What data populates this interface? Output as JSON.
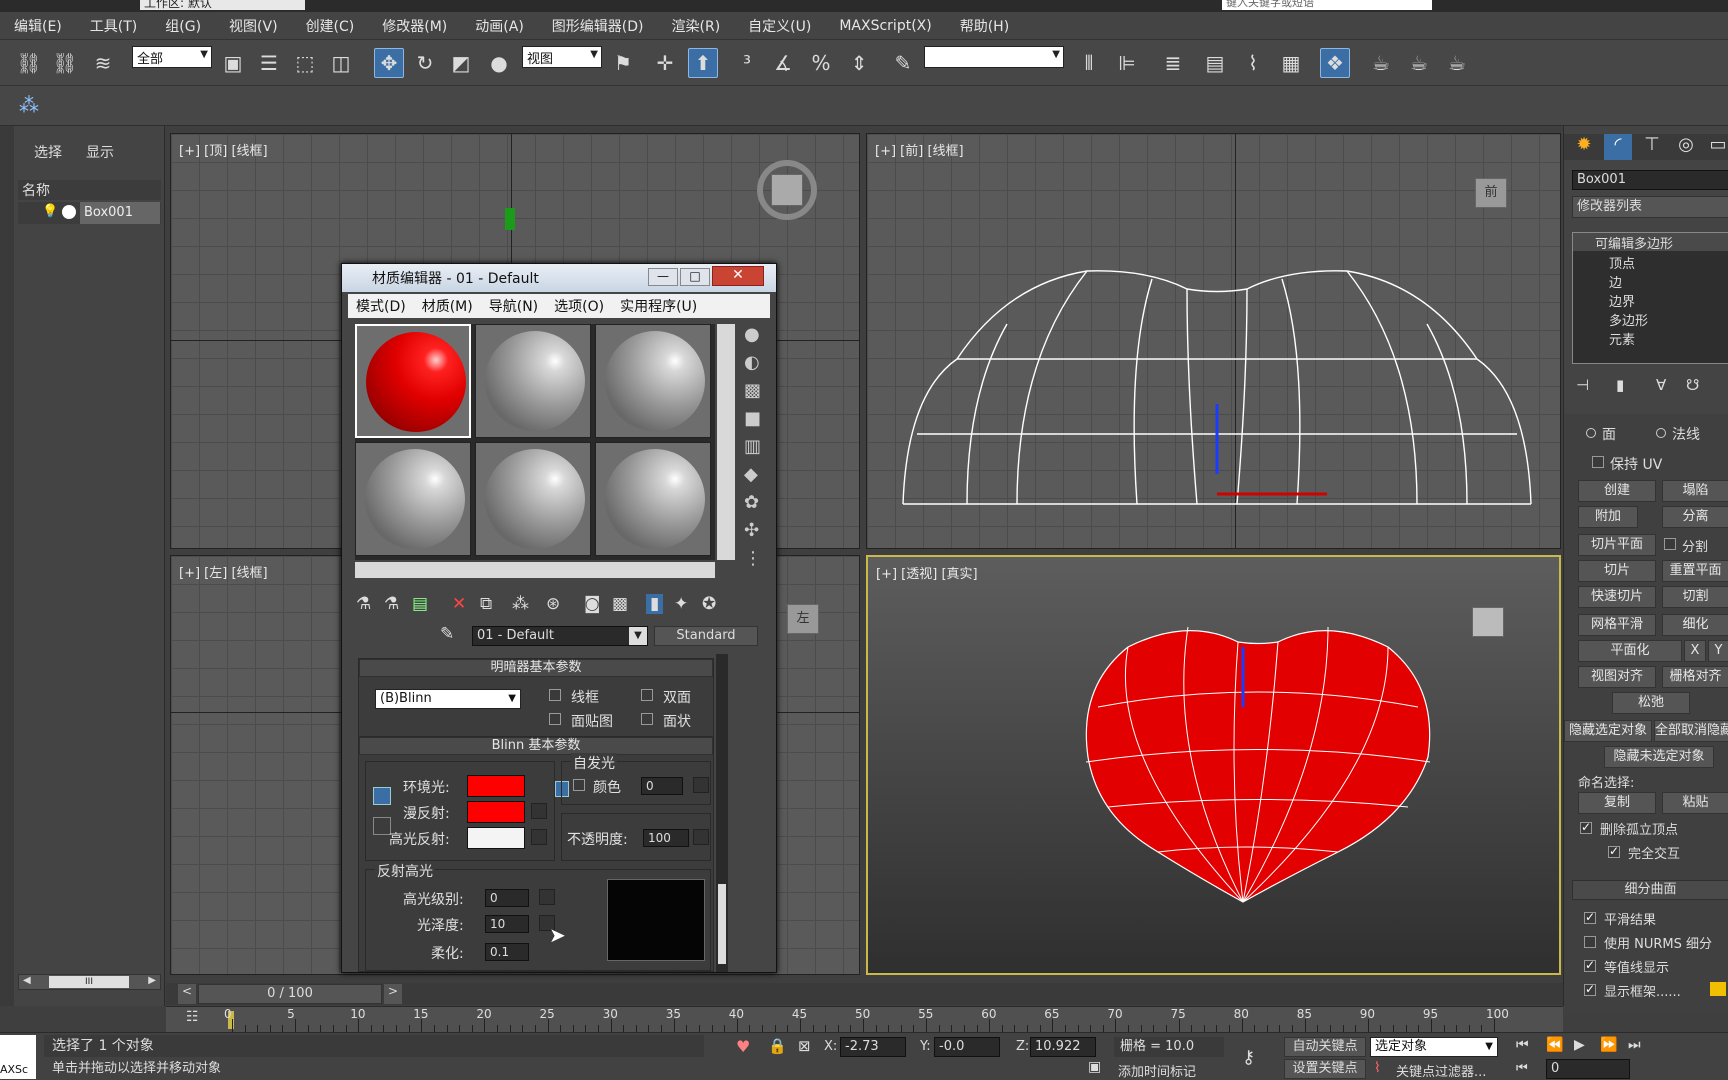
{
  "title": {
    "workspace_label": "工作区: 默认",
    "search_placeholder": "键入关键字或短语"
  },
  "menu": [
    "编辑(E)",
    "工具(T)",
    "组(G)",
    "视图(V)",
    "创建(C)",
    "修改器(M)",
    "动画(A)",
    "图形编辑器(D)",
    "渲染(R)",
    "自定义(U)",
    "MAXScript(X)",
    "帮助(H)"
  ],
  "toolbar": {
    "selection_filter": "全部",
    "ref_coord": "视图"
  },
  "explorer": {
    "tabs": [
      "选择",
      "显示"
    ],
    "column": "名称",
    "object": "Box001",
    "scroll_value": "III"
  },
  "viewports": {
    "top": "[+] [顶] [线框]",
    "front": "[+] [前] [线框]",
    "left": "[+] [左] [线框]",
    "persp": "[+] [透视] [真实]",
    "front_cube": "前",
    "left_cube": "左"
  },
  "mated": {
    "title": "材质编辑器 - 01 - Default",
    "menu": [
      "模式(D)",
      "材质(M)",
      "导航(N)",
      "选项(O)",
      "实用程序(U)"
    ],
    "material_name": "01 - Default",
    "material_type": "Standard",
    "shader_rollout": "明暗器基本参数",
    "shader": "(B)Blinn",
    "opt_wire": "线框",
    "opt_2side": "双面",
    "opt_facemap": "面贴图",
    "opt_faceted": "面状",
    "blinn_rollout": "Blinn 基本参数",
    "self_illum": "自发光",
    "color_label": "颜色",
    "self_illum_value": "0",
    "ambient": "环境光:",
    "diffuse": "漫反射:",
    "specular": "高光反射:",
    "opacity_label": "不透明度:",
    "opacity_value": "100",
    "spec_group": "反射高光",
    "spec_level_label": "高光级别:",
    "spec_level": "0",
    "gloss_label": "光泽度:",
    "gloss": "10",
    "soften_label": "柔化:",
    "soften": "0.1",
    "colors": {
      "ambient": "#ff0000",
      "diffuse": "#ff0000",
      "specular": "#f4f4f4"
    }
  },
  "cmd": {
    "object_name": "Box001",
    "modifier_list": "修改器列表",
    "stack": [
      "可编辑多边形",
      "顶点",
      "边",
      "边界",
      "多边形",
      "元素"
    ],
    "radio_face": "面",
    "radio_normal": "法线",
    "keep_uv": "保持 UV",
    "btn_create": "创建",
    "btn_collapse": "塌陷",
    "btn_attach": "附加",
    "btn_detach": "分离",
    "btn_slice_plane": "切片平面",
    "chk_split": "分割",
    "btn_slice": "切片",
    "btn_reset_plane": "重置平面",
    "btn_quickslice": "快速切片",
    "btn_cut": "切割",
    "btn_meshsmooth": "网格平滑",
    "btn_tessellate": "细化",
    "btn_planarize": "平面化",
    "btn_x": "X",
    "btn_y": "Y",
    "btn_view_align": "视图对齐",
    "btn_grid_align": "栅格对齐",
    "btn_relax": "松弛",
    "btn_hide_sel": "隐藏选定对象",
    "btn_unhide_all": "全部取消隐藏",
    "btn_hide_unsel": "隐藏未选定对象",
    "named_sel": "命名选择:",
    "btn_copy": "复制",
    "btn_paste": "粘贴",
    "chk_delete_iso": "删除孤立顶点",
    "chk_full_interact": "完全交互",
    "subdiv_rollout": "细分曲面",
    "chk_smooth_result": "平滑结果",
    "chk_nurms": "使用 NURMS 细分",
    "chk_isoline": "等值线显示",
    "chk_show_cage": "显示框架......"
  },
  "timeline": {
    "frame": "0 / 100",
    "ticks": [
      "0",
      "5",
      "10",
      "15",
      "20",
      "25",
      "30",
      "35",
      "40",
      "45",
      "50",
      "55",
      "60",
      "65",
      "70",
      "75",
      "80",
      "85",
      "90",
      "95",
      "100"
    ]
  },
  "status": {
    "maxscript": "AXSc",
    "selected": "选择了 1 个对象",
    "prompt": "单击并拖动以选择并移动对象",
    "x_label": "X:",
    "x": "-2.73",
    "y_label": "Y:",
    "y": "-0.0",
    "z_label": "Z:",
    "z": "10.922",
    "grid": "栅格 = 10.0",
    "add_time_tag": "添加时间标记",
    "auto_key": "自动关键点",
    "set_key": "设置关键点",
    "selected_set": "选定对象",
    "key_filters": "关键点过滤器...",
    "frame_field": "0"
  }
}
